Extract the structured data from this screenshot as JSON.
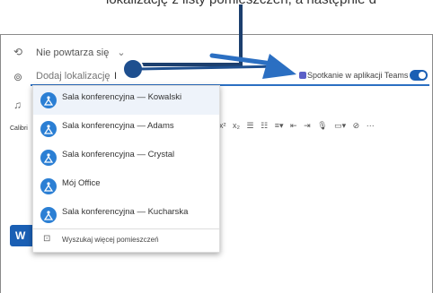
{
  "caption": {
    "text": "lokalizację z listy pomieszczeń, a następnie d"
  },
  "recurrence": {
    "value": "Nie powtarza się",
    "chevron": "chevron-down-icon"
  },
  "location": {
    "placeholder": "Dodaj lokalizację"
  },
  "teams": {
    "label": "Spotkanie w aplikacji Teams",
    "toggle_on": true
  },
  "editor": {
    "font_label": "Calibri",
    "send_button": "W"
  },
  "rooms": [
    {
      "label": "Sala konferencyjna — Kowalski",
      "selected": true
    },
    {
      "label": "Sala konferencyjna — Adams",
      "selected": false
    },
    {
      "label": "Sala konferencyjna — Crystal",
      "selected": false
    },
    {
      "label": "Mój Office",
      "selected": false
    },
    {
      "label": "Sala konferencyjna — Kucharska",
      "selected": false
    }
  ],
  "search_more": {
    "label": "Wyszukaj więcej pomieszczeń"
  },
  "toolbar": {
    "items": [
      "x²",
      "x₂",
      "☰",
      "☷",
      "≡▾",
      "⇤",
      "⇥",
      "🎙",
      "▭▾",
      "⊘",
      "⋯"
    ]
  },
  "colors": {
    "accent": "#1a5fb4",
    "arrow": "#2b6fc2",
    "room_icon": "#2b7fd4"
  }
}
